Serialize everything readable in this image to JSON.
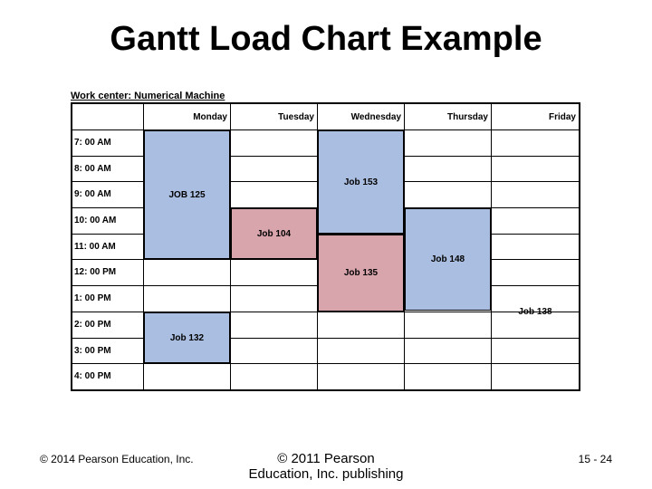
{
  "title": "Gantt Load Chart Example",
  "caption": "Work center: Numerical Machine",
  "days": [
    "Monday",
    "Tuesday",
    "Wednesday",
    "Thursday",
    "Friday"
  ],
  "times": [
    "7: 00 AM",
    "8: 00 AM",
    "9: 00 AM",
    "10: 00 AM",
    "11: 00 AM",
    "12: 00 PM",
    "1: 00 PM",
    "2: 00 PM",
    "3: 00 PM",
    "4: 00 PM"
  ],
  "jobs": {
    "job125": "JOB 125",
    "job153": "Job 153",
    "job104": "Job 104",
    "job148": "Job 148",
    "job135": "Job 135",
    "job138": "Job 138",
    "job132": "Job 132"
  },
  "footer": {
    "left": "© 2014 Pearson Education, Inc.",
    "center_line1": "© 2011 Pearson",
    "center_line2": "Education, Inc. publishing",
    "page": "15 - 24"
  },
  "chart_data": {
    "type": "gantt",
    "title": "Gantt Load Chart Example",
    "resource": "Numerical Machine",
    "categories": [
      "Monday",
      "Tuesday",
      "Wednesday",
      "Thursday",
      "Friday"
    ],
    "time_slots": [
      "7:00 AM",
      "8:00 AM",
      "9:00 AM",
      "10:00 AM",
      "11:00 AM",
      "12:00 PM",
      "1:00 PM",
      "2:00 PM",
      "3:00 PM",
      "4:00 PM"
    ],
    "tasks": [
      {
        "name": "JOB 125",
        "day": "Monday",
        "start": "7:00 AM",
        "end": "12:00 PM"
      },
      {
        "name": "Job 132",
        "day": "Monday",
        "start": "2:00 PM",
        "end": "4:00 PM"
      },
      {
        "name": "Job 104",
        "day": "Tuesday",
        "start": "10:00 AM",
        "end": "12:00 PM"
      },
      {
        "name": "Job 153",
        "day": "Wednesday",
        "start": "7:00 AM",
        "end": "11:00 AM"
      },
      {
        "name": "Job 135",
        "day": "Wednesday",
        "start": "11:00 AM",
        "end": "2:00 PM"
      },
      {
        "name": "Job 148",
        "day": "Thursday",
        "start": "10:00 AM",
        "end": "1:00 PM"
      },
      {
        "name": "Job 138",
        "day": "Friday",
        "start": "1:00 PM",
        "end": "3:00 PM"
      }
    ]
  }
}
